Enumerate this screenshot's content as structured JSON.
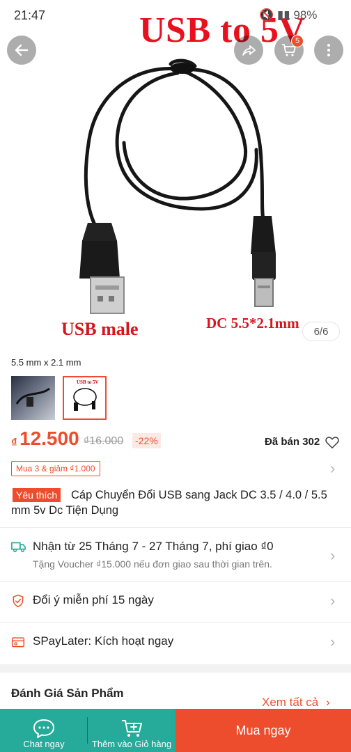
{
  "status_bar": {
    "time": "21:47",
    "battery": "98%"
  },
  "hero": {
    "caption_top": "USB to 5V",
    "caption_left": "USB male",
    "caption_right": "DC 5.5*2.1mm",
    "counter": "6/6",
    "cart_count": "5"
  },
  "variant": {
    "selected_name": "5.5 mm x 2.1 mm",
    "thumb2_text": "USB to 5V"
  },
  "price": {
    "currency": "₫",
    "current": "12.500",
    "original": "₫16.000",
    "discount": "-22%",
    "sold": "Đã bán 302"
  },
  "promo": {
    "label": "Mua 3 & giảm ₫1.000"
  },
  "title": {
    "badge": "Yêu thích",
    "text": "Cáp Chuyển Đổi USB sang Jack DC 3.5 / 4.0 / 5.5 mm 5v Dc Tiện Dụng"
  },
  "shipping": {
    "line": "Nhận từ 25 Tháng 7 - 27 Tháng 7, phí giao ₫0",
    "sub": "Tặng Voucher ₫15.000 nếu đơn giao sau thời gian trên."
  },
  "returns": {
    "line": "Đổi ý miễn phí 15 ngày"
  },
  "paylater": {
    "line": "SPayLater: Kích hoạt ngay"
  },
  "reviews": {
    "title": "Đánh Giá Sản Phẩm",
    "see_all": "Xem tất cả"
  },
  "bottom_bar": {
    "chat_label": "Chat ngay",
    "add_cart_label": "Thêm vào Giỏ hàng",
    "buy_label": "Mua ngay"
  },
  "colors": {
    "accent": "#ee4d2d",
    "teal": "#26aa99"
  },
  "icons": [
    "back-arrow-icon",
    "share-icon",
    "cart-icon",
    "more-icon",
    "heart-icon",
    "truck-icon",
    "shield-icon",
    "paylater-icon",
    "chat-icon",
    "add-cart-icon",
    "chevron-right-icon"
  ]
}
